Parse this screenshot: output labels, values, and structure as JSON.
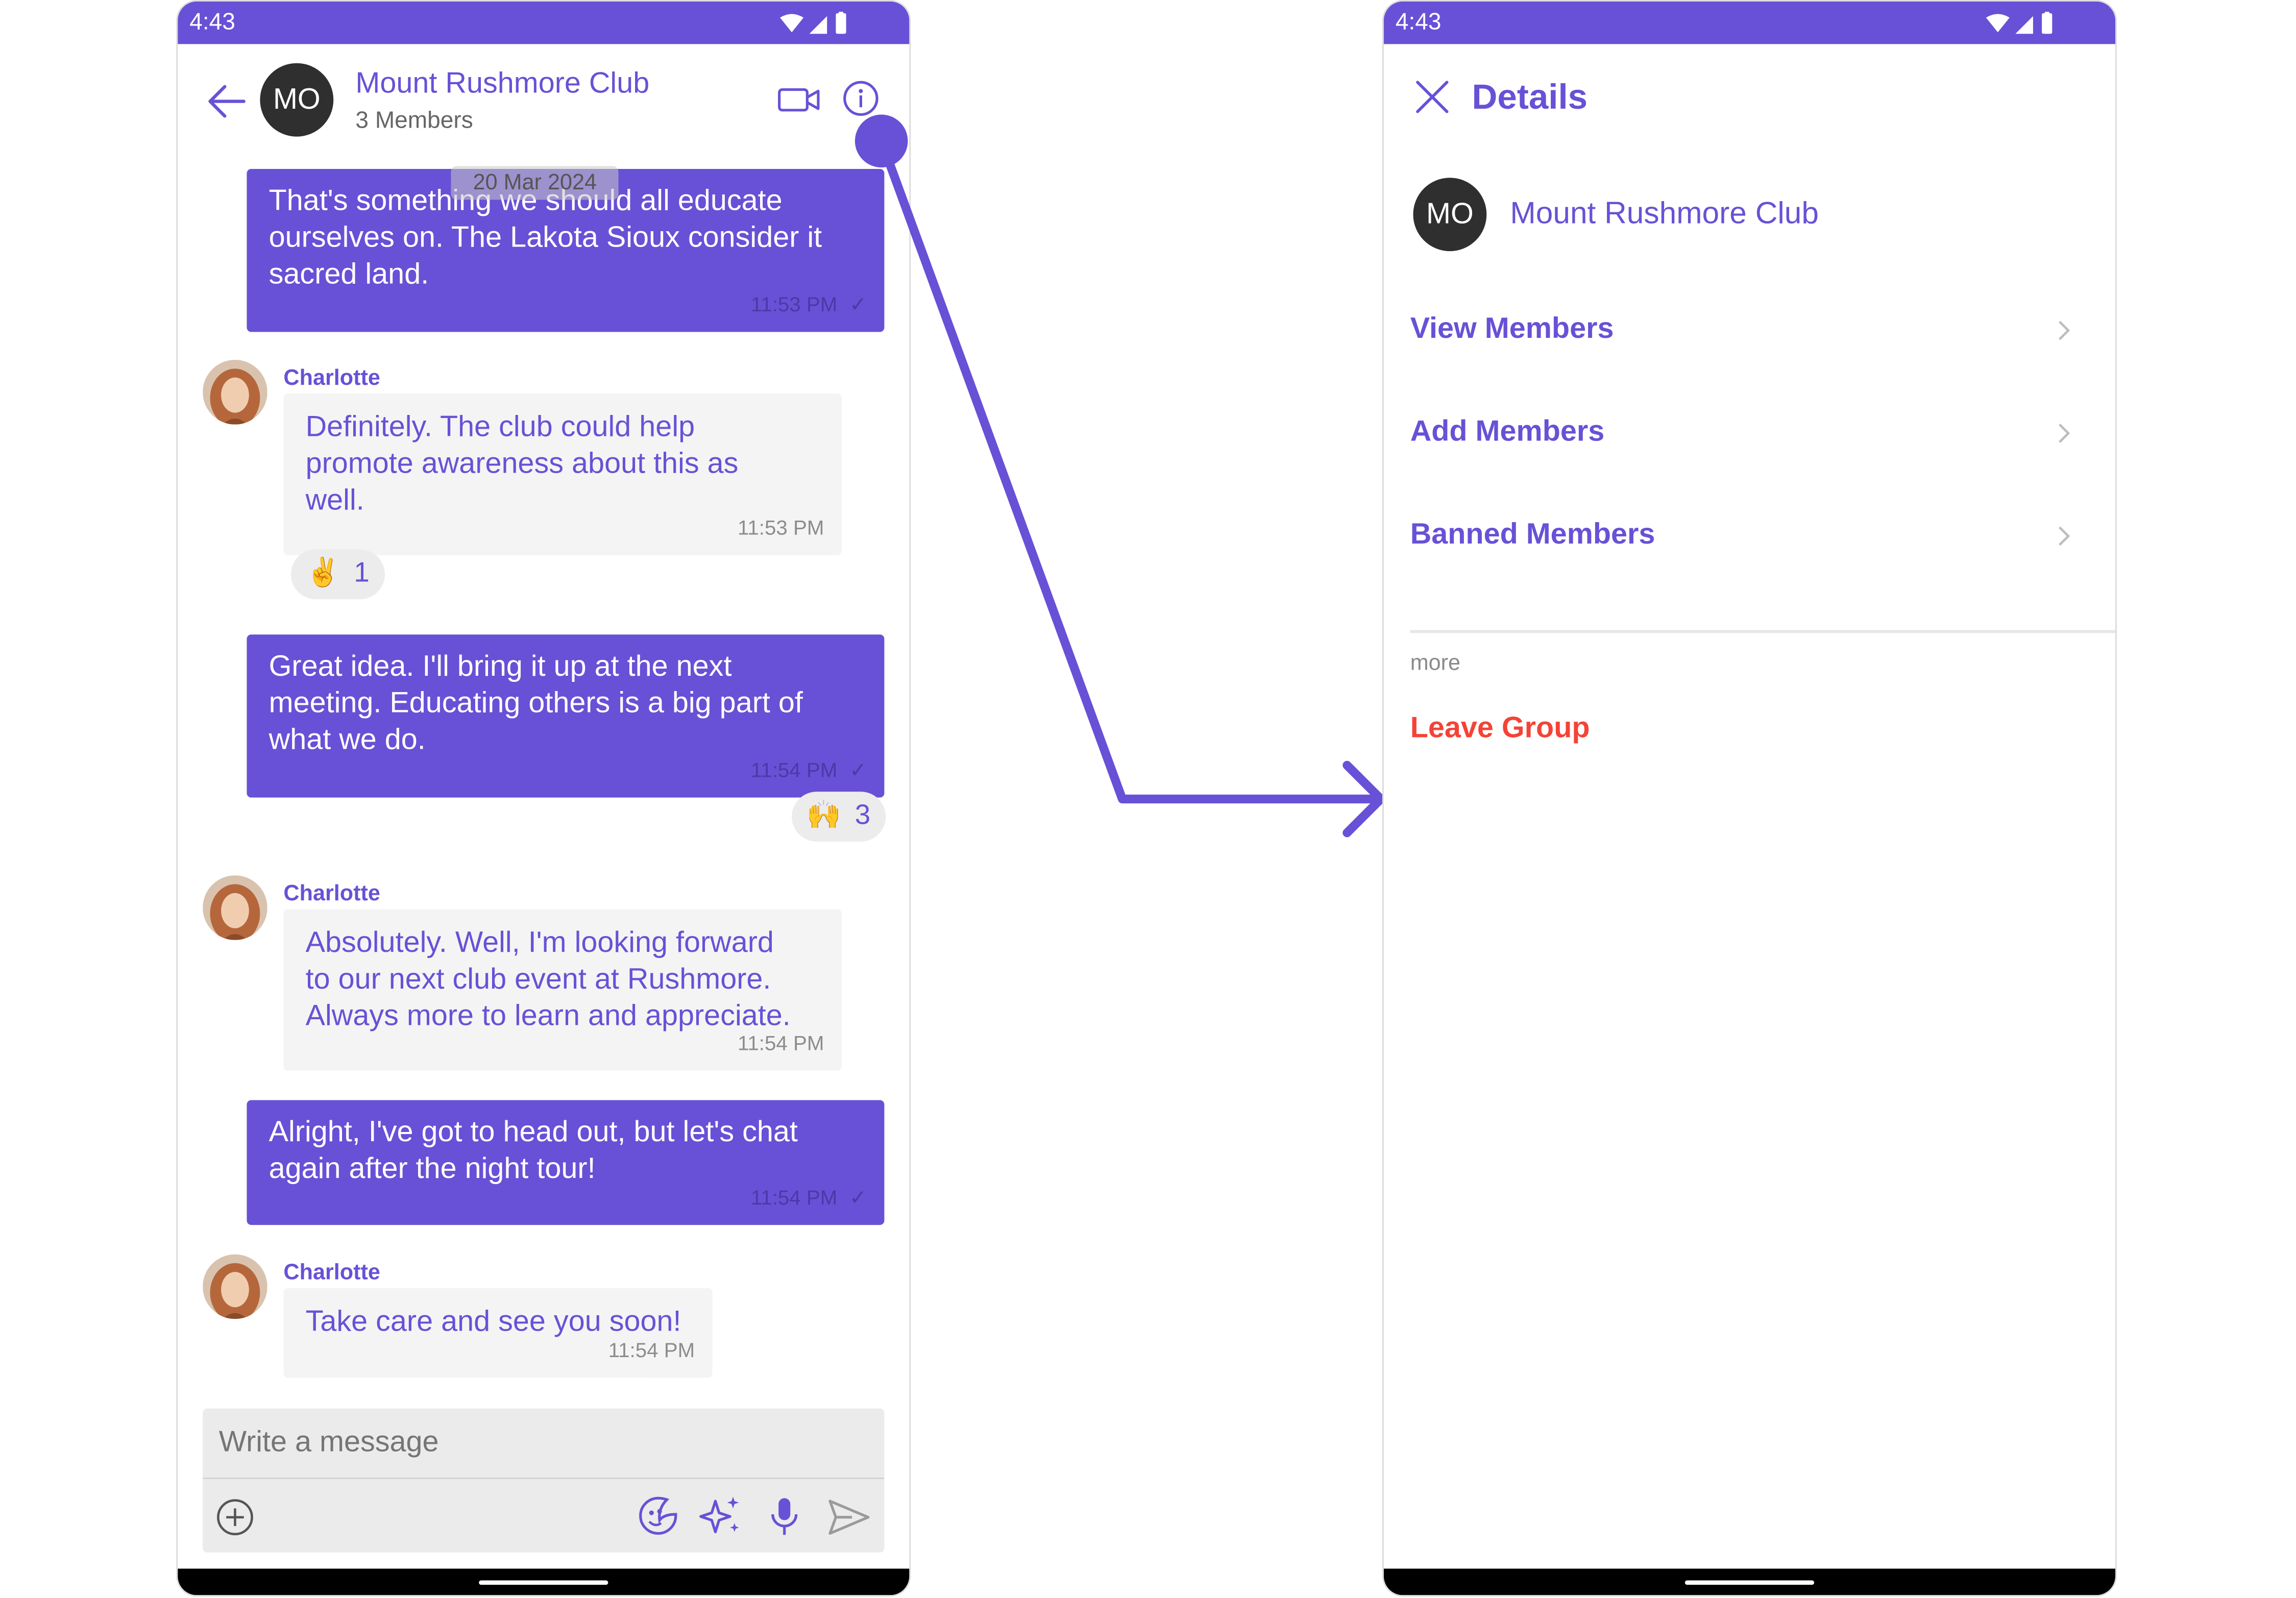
{
  "colors": {
    "accent": "#6851d6",
    "danger": "#f44336",
    "incoming_bg": "#f4f4f4"
  },
  "left_phone": {
    "status_time": "4:43",
    "header": {
      "avatar_initials": "MO",
      "title": "Mount Rushmore Club",
      "subtitle": "3 Members",
      "icons": [
        "back-arrow-icon",
        "video-call-icon",
        "info-icon"
      ]
    },
    "date_separator": "20 Mar 2024",
    "messages": [
      {
        "lines": [
          "That's something we should all educate",
          "ourselves on. The Lakota Sioux consider it",
          "sacred land."
        ],
        "time": "11:53 PM",
        "receipt": "✓"
      },
      {
        "sender": "Charlotte",
        "lines": [
          "Definitely. The club could help",
          "promote awareness about this as",
          "well."
        ],
        "time": "11:53 PM",
        "reaction": {
          "emoji": "✌",
          "count": "1"
        }
      },
      {
        "lines": [
          "Great idea. I'll bring it up at the next",
          "meeting. Educating others is a big part of",
          "what we do."
        ],
        "time": "11:54 PM",
        "receipt": "✓",
        "reaction": {
          "emoji": "🙌",
          "count": "3"
        }
      },
      {
        "sender": "Charlotte",
        "lines": [
          "Absolutely. Well, I'm looking forward",
          "to our next club event at Rushmore.",
          "Always more to learn and appreciate."
        ],
        "time": "11:54 PM"
      },
      {
        "lines": [
          "Alright, I've got to head out, but let's chat",
          "again after the night tour!"
        ],
        "time": "11:54 PM",
        "receipt": "✓"
      },
      {
        "sender": "Charlotte",
        "lines": [
          "Take care and see you soon!"
        ],
        "time": "11:54 PM"
      }
    ],
    "composer": {
      "placeholder": "Write a message",
      "icons": [
        "add-attachment-icon",
        "sticker-icon",
        "ai-sparkle-icon",
        "microphone-icon",
        "send-icon"
      ]
    }
  },
  "right_phone": {
    "status_time": "4:43",
    "header": {
      "title": "Details",
      "icon": "close-icon"
    },
    "group": {
      "avatar_initials": "MO",
      "name": "Mount Rushmore Club"
    },
    "menu_items": [
      "View Members",
      "Add Members",
      "Banned Members"
    ],
    "section_label": "more",
    "leave_label": "Leave Group"
  }
}
